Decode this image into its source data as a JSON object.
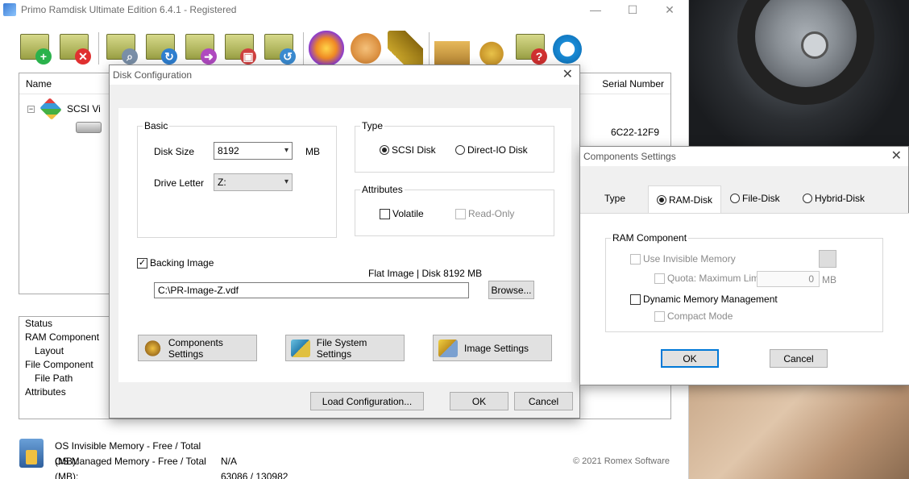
{
  "main": {
    "title": "Primo Ramdisk Ultimate Edition 6.4.1 - Registered",
    "list": {
      "col_name": "Name",
      "col_serial": "Serial Number",
      "tree_root": "SCSI Vi",
      "serial_value": "6C22-12F9"
    },
    "properties": [
      "Status",
      "RAM Component",
      "Layout",
      "File Component",
      "File Path",
      "Attributes"
    ],
    "status": {
      "invisible_label": "OS Invisible Memory - Free / Total (MB):",
      "invisible_value": "N/A",
      "managed_label": "OS Managed Memory - Free / Total (MB):",
      "managed_value": "63086 / 130982"
    },
    "copyright": "© 2021 Romex Software"
  },
  "toolbar": {
    "icons": [
      "add-disk-icon",
      "remove-disk-icon",
      "inspect-icon",
      "refresh-icon",
      "export-icon",
      "save-image-icon",
      "load-image-icon",
      "media-icon",
      "theme-icon",
      "chip-icon",
      "tools-icon",
      "lock-icon",
      "help-icon",
      "about-icon"
    ]
  },
  "disk_config": {
    "title": "Disk Configuration",
    "basic_label": "Basic",
    "disk_size_label": "Disk Size",
    "disk_size_value": "8192",
    "disk_size_unit": "MB",
    "drive_letter_label": "Drive Letter",
    "drive_letter_value": "Z:",
    "type_label": "Type",
    "type_scsi": "SCSI Disk",
    "type_direct": "Direct-IO Disk",
    "attributes_label": "Attributes",
    "volatile_label": "Volatile",
    "readonly_label": "Read-Only",
    "backing_image_label": "Backing Image",
    "image_info": "Flat Image | Disk 8192 MB",
    "image_path": "C:\\PR-Image-Z.vdf",
    "browse_label": "Browse...",
    "components_label": "Components Settings",
    "filesystem_label": "File System Settings",
    "image_settings_label": "Image Settings",
    "load_config_label": "Load Configuration...",
    "ok_label": "OK",
    "cancel_label": "Cancel"
  },
  "components": {
    "title": "Components Settings",
    "tab_type": "Type",
    "tab_ram": "RAM-Disk",
    "tab_file": "File-Disk",
    "tab_hybrid": "Hybrid-Disk",
    "ram_component_label": "RAM Component",
    "use_invisible_label": "Use Invisible Memory",
    "quota_label": "Quota: Maximum Limit",
    "quota_value": "0",
    "quota_unit": "MB",
    "dynamic_label": "Dynamic Memory Management",
    "compact_label": "Compact Mode",
    "ok_label": "OK",
    "cancel_label": "Cancel"
  }
}
